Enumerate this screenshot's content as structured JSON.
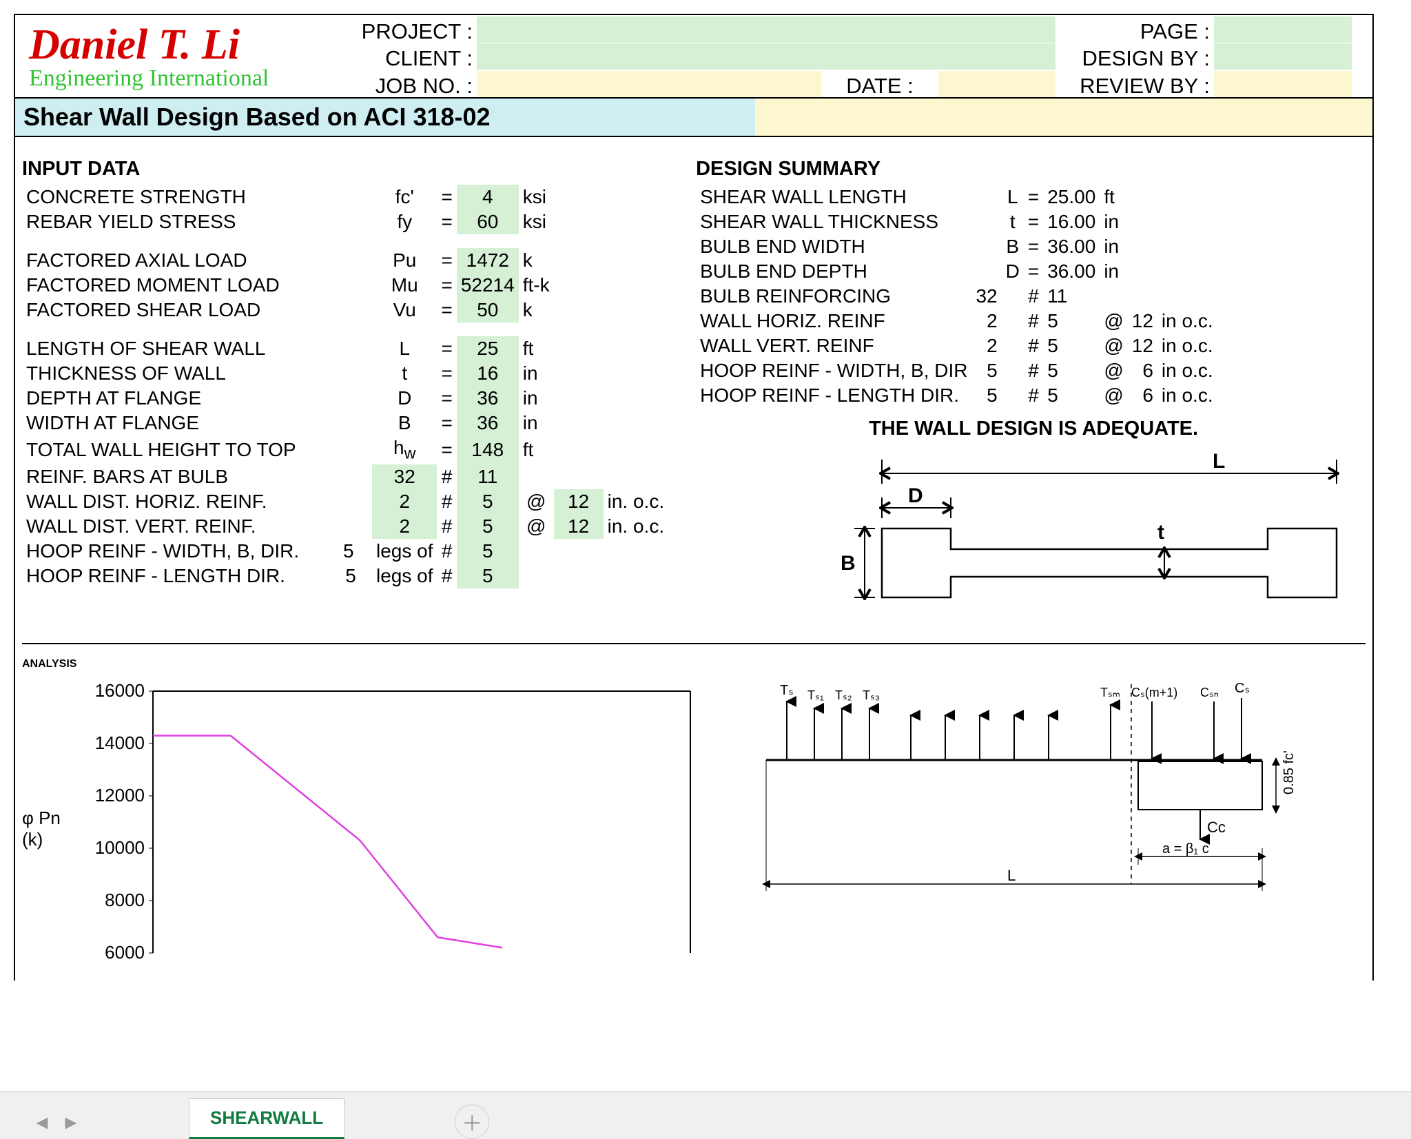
{
  "logo": {
    "name": "Daniel T. Li",
    "sub": "Engineering International"
  },
  "header": {
    "labels": {
      "project": "PROJECT :",
      "client": "CLIENT :",
      "jobno": "JOB NO. :",
      "date": "DATE :",
      "page": "PAGE :",
      "designby": "DESIGN BY :",
      "reviewby": "REVIEW BY :"
    },
    "values": {
      "project": "",
      "client": "",
      "jobno": "",
      "date": "",
      "page": "",
      "designby": "",
      "reviewby": ""
    }
  },
  "title": "Shear Wall Design Based on ACI 318-02",
  "input_heading": "INPUT DATA",
  "summary_heading": "DESIGN SUMMARY",
  "adequate": "THE WALL DESIGN IS ADEQUATE.",
  "analysis_heading": "ANALYSIS",
  "input": {
    "concrete": {
      "label": "CONCRETE STRENGTH",
      "sym": "fc'",
      "val": "4",
      "unit": "ksi"
    },
    "rebar": {
      "label": "REBAR YIELD STRESS",
      "sym": "fy",
      "val": "60",
      "unit": "ksi"
    },
    "pu": {
      "label": "FACTORED AXIAL LOAD",
      "sym": "Pu",
      "val": "1472",
      "unit": "k"
    },
    "mu": {
      "label": "FACTORED MOMENT LOAD",
      "sym": "Mu",
      "val": "52214",
      "unit": "ft-k"
    },
    "vu": {
      "label": "FACTORED SHEAR LOAD",
      "sym": "Vu",
      "val": "50",
      "unit": "k"
    },
    "L": {
      "label": "LENGTH OF SHEAR WALL",
      "sym": "L",
      "val": "25",
      "unit": "ft"
    },
    "t": {
      "label": "THICKNESS OF  WALL",
      "sym": "t",
      "val": "16",
      "unit": "in"
    },
    "D": {
      "label": "DEPTH AT FLANGE",
      "sym": "D",
      "val": "36",
      "unit": "in"
    },
    "B": {
      "label": "WIDTH AT FLANGE",
      "sym": "B",
      "val": "36",
      "unit": "in"
    },
    "hw": {
      "label": "TOTAL WALL HEIGHT TO TOP",
      "sym": "h<sub>w</sub>",
      "val": "148",
      "unit": "ft"
    },
    "bulb": {
      "label": "REINF.  BARS AT BULB",
      "n": "32",
      "hash": "#",
      "size": "11"
    },
    "horiz": {
      "label": "WALL DIST. HORIZ. REINF.",
      "n": "2",
      "hash": "#",
      "size": "5",
      "at": "@",
      "sp": "12",
      "unit": "in. o.c."
    },
    "vert": {
      "label": "WALL DIST. VERT. REINF.",
      "n": "2",
      "hash": "#",
      "size": "5",
      "at": "@",
      "sp": "12",
      "unit": "in. o.c."
    },
    "hoopB": {
      "label": "HOOP REINF - WIDTH, B, DIR.",
      "n": "5",
      "legs": "legs of",
      "hash": "#",
      "size": "5"
    },
    "hoopL": {
      "label": "HOOP REINF - LENGTH DIR.",
      "n": "5",
      "legs": "legs of",
      "hash": "#",
      "size": "5"
    }
  },
  "summary": {
    "L": {
      "label": "SHEAR WALL LENGTH",
      "sym": "L",
      "val": "25.00",
      "unit": "ft"
    },
    "t": {
      "label": "SHEAR WALL THICKNESS",
      "sym": "t",
      "val": "16.00",
      "unit": "in"
    },
    "B": {
      "label": "BULB END WIDTH",
      "sym": "B",
      "val": "36.00",
      "unit": "in"
    },
    "D": {
      "label": "BULB END DEPTH",
      "sym": "D",
      "val": "36.00",
      "unit": "in"
    },
    "bulb": {
      "label": "BULB REINFORCING",
      "n": "32",
      "hash": "#",
      "size": "11"
    },
    "wh": {
      "label": "WALL HORIZ. REINF",
      "n": "2",
      "hash": "#",
      "size": "5",
      "at": "@",
      "sp": "12",
      "unit": "in o.c."
    },
    "wv": {
      "label": "WALL VERT. REINF",
      "n": "2",
      "hash": "#",
      "size": "5",
      "at": "@",
      "sp": "12",
      "unit": "in o.c."
    },
    "hb": {
      "label": "HOOP REINF - WIDTH, B, DIR",
      "n": "5",
      "hash": "#",
      "size": "5",
      "at": "@",
      "sp": "6",
      "unit": "in o.c."
    },
    "hl": {
      "label": "HOOP REINF - LENGTH DIR.",
      "n": "5",
      "hash": "#",
      "size": "5",
      "at": "@",
      "sp": "6",
      "unit": "in o.c."
    }
  },
  "cross_labels": {
    "L": "L",
    "D": "D",
    "t": "t",
    "B": "B"
  },
  "chart_data": {
    "type": "line",
    "title": "",
    "xlabel": "",
    "ylabel": "φ Pn (k)",
    "ylim": [
      6000,
      16000
    ],
    "ytick": [
      6000,
      8000,
      10000,
      12000,
      14000,
      16000
    ],
    "x": [
      0,
      120,
      320,
      440,
      540
    ],
    "y": [
      14300,
      14300,
      10300,
      6600,
      6200
    ],
    "series_color": "#e040e0"
  },
  "force_labels": {
    "Ts": "Tₛ",
    "Ts1": "Tₛ₁",
    "Ts2": "Tₛ₂",
    "Ts3": "Tₛ₃",
    "Tsm": "Tₛₘ",
    "Csm1": "Cₛ(m+1)",
    "Csn": "Cₛₙ",
    "Cs": "Cₛ",
    "Cc": "Cc",
    "a": "a  =  β₁ c",
    "L": "L",
    "fc": "0.85 fc'"
  },
  "tabs": {
    "active": "SHEARWALL"
  }
}
